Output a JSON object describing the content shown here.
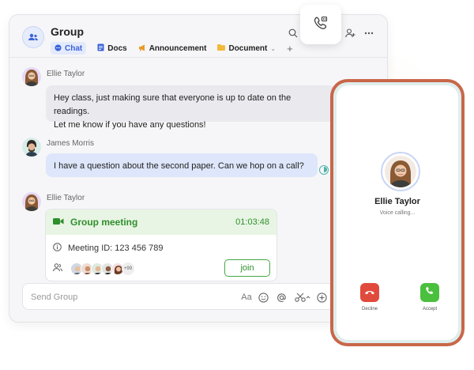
{
  "chat": {
    "title": "Group",
    "tabs": [
      {
        "label": "Chat",
        "icon": "chat-bubble-icon"
      },
      {
        "label": "Docs",
        "icon": "docs-icon"
      },
      {
        "label": "Announcement",
        "icon": "megaphone-icon"
      },
      {
        "label": "Document",
        "icon": "folder-icon"
      }
    ],
    "tab_add": "+",
    "header_actions": [
      "search-icon",
      "video-call-icon",
      "add-member-icon",
      "more-icon"
    ]
  },
  "messages": [
    {
      "sender": "Ellie Taylor",
      "text_line1": "Hey class, just making sure that everyone is up to date on the readings.",
      "text_line2": "Let me know if you have any questions!"
    },
    {
      "sender": "James Morris",
      "text": "I have a question about the second paper. Can we hop on a call?"
    },
    {
      "sender": "Ellie Taylor"
    }
  ],
  "meeting": {
    "title": "Group meeting",
    "duration": "01:03:48",
    "meeting_id": "Meeting ID: 123 456 789",
    "more_count": "+99",
    "join_label": "join"
  },
  "composer": {
    "placeholder": "Send Group",
    "tools": [
      "text-format-icon",
      "emoji-icon",
      "mention-icon",
      "scissors-icon",
      "add-icon"
    ],
    "format_glyph": "Aa"
  },
  "incoming_call": {
    "caller_name": "Ellie Taylor",
    "status": "Voice calling...",
    "decline_label": "Decline",
    "accept_label": "Accept"
  },
  "colors": {
    "accent_blue": "#3b63d8",
    "meeting_green": "#2f8f2c",
    "decline_red": "#e04a3c",
    "accept_green": "#4bbf3e",
    "phone_frame": "#c9674a"
  }
}
